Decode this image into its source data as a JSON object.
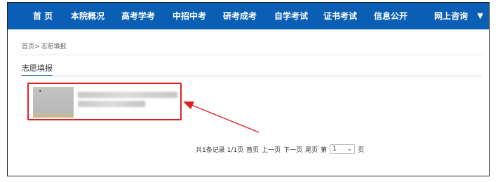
{
  "nav": {
    "items": [
      "首 页",
      "本院概况",
      "高考学考",
      "中招中考",
      "研考成考",
      "自学考试",
      "证书考试",
      "信息公开",
      "网上咨询"
    ],
    "caret": "▼",
    "background": "#0a5fb4"
  },
  "breadcrumb": {
    "home": "首页>",
    "current": "志愿填报"
  },
  "section": {
    "title": "志愿填报"
  },
  "pager": {
    "summary": "共1条记录 1/1页",
    "first": "首页",
    "prev": "上一页",
    "next": "下一页",
    "last": "尾页",
    "page_prefix": "第",
    "page_value": "1",
    "page_suffix": "页"
  },
  "colors": {
    "highlight": "#e02020",
    "accent": "#0a5fb4"
  }
}
